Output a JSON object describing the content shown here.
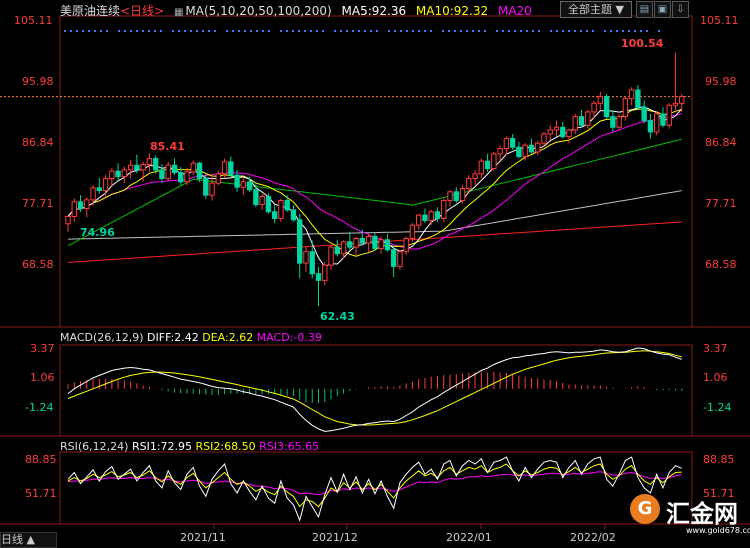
{
  "main_panel": {
    "instrument": "美原油连续",
    "period_label": "<日线>",
    "ma_label": "MA(5,10,20,50,100,200)",
    "ma5_label": "MA5:92.36",
    "ma10_label": "MA10:92.32",
    "ma20_label": "MA20",
    "theme_button": "全部主题",
    "peak_label": "100.54",
    "high_label_nov": "85.41",
    "low_label_oct": "74.96",
    "low_label_dec": "62.43",
    "y_ticks": [
      "105.11",
      "95.98",
      "86.84",
      "77.71",
      "68.58"
    ],
    "colors": {
      "up": "#ff3b3b",
      "down": "#00d4a0",
      "ma5": "#ffffff",
      "ma10": "#ffff00",
      "ma20": "#ff00ff",
      "ma50": "#00c000",
      "ma100": "#c0c0c0",
      "ma200": "#ff2020",
      "axis_text": "#ff3b3b",
      "dotted": "#3a7dff"
    }
  },
  "macd_panel": {
    "title": "MACD(26,12,9)",
    "diff_label": "DIFF:2.42",
    "dea_label": "DEA:2.62",
    "macd_label": "MACD:-0.39",
    "y_ticks": [
      "3.37",
      "1.06",
      "-1.24"
    ]
  },
  "rsi_panel": {
    "title": "RSI(6,12,24)",
    "rsi1_label": "RSI1:72.95",
    "rsi2_label": "RSI2:68.50",
    "rsi3_label": "RSI3:65.65",
    "y_ticks": [
      "88.85",
      "51.71"
    ]
  },
  "x_axis": {
    "labels": [
      "2021/11",
      "2021/12",
      "2022/01",
      "2022/02"
    ]
  },
  "footer": {
    "period_button": "日线 ▲"
  },
  "logo": {
    "text": "汇金网",
    "mark": "G",
    "url": "www.gold678.com"
  },
  "chart_data": {
    "type": "candlestick",
    "title": "美原油连续<日线>",
    "ylim": [
      62.43,
      105.11
    ],
    "series": [
      {
        "name": "MA5",
        "last": 92.36
      },
      {
        "name": "MA10",
        "last": 92.32
      },
      {
        "name": "MA20"
      }
    ],
    "annotations": [
      {
        "label": "85.41",
        "type": "high"
      },
      {
        "label": "74.96",
        "type": "low"
      },
      {
        "label": "62.43",
        "type": "low"
      },
      {
        "label": "100.54",
        "type": "high"
      }
    ],
    "candles": [
      [
        74.8,
        76.2,
        73.6,
        75.9
      ],
      [
        75.9,
        78.6,
        75.1,
        78.1
      ],
      [
        78.1,
        79.1,
        76.6,
        77.1
      ],
      [
        77.1,
        78.8,
        75.8,
        78.4
      ],
      [
        78.4,
        80.6,
        77.6,
        80.2
      ],
      [
        80.2,
        81.7,
        79.3,
        79.8
      ],
      [
        79.8,
        82.1,
        78.9,
        81.6
      ],
      [
        81.6,
        83.2,
        80.3,
        82.7
      ],
      [
        82.7,
        83.9,
        81.4,
        81.9
      ],
      [
        81.9,
        83.4,
        80.9,
        82.9
      ],
      [
        82.9,
        84.3,
        81.6,
        83.6
      ],
      [
        83.6,
        85.2,
        82.4,
        82.9
      ],
      [
        82.9,
        84.1,
        81.2,
        83.7
      ],
      [
        83.7,
        85.41,
        82.6,
        84.6
      ],
      [
        84.6,
        85.1,
        82.3,
        82.9
      ],
      [
        82.9,
        83.8,
        80.9,
        81.6
      ],
      [
        81.6,
        84.1,
        81.2,
        83.6
      ],
      [
        83.6,
        84.6,
        82.1,
        82.5
      ],
      [
        82.5,
        83.3,
        80.6,
        81.1
      ],
      [
        81.1,
        83.2,
        80.6,
        82.6
      ],
      [
        82.6,
        84.3,
        82.1,
        83.9
      ],
      [
        83.9,
        84.1,
        81.1,
        81.6
      ],
      [
        81.6,
        82.2,
        78.6,
        79.1
      ],
      [
        79.1,
        81.6,
        78.3,
        80.9
      ],
      [
        80.9,
        82.8,
        80.6,
        82.3
      ],
      [
        82.3,
        84.6,
        81.6,
        84.1
      ],
      [
        84.1,
        84.9,
        81.8,
        82.1
      ],
      [
        82.1,
        82.9,
        79.6,
        80.3
      ],
      [
        80.3,
        81.6,
        79.1,
        81.1
      ],
      [
        81.1,
        81.9,
        79.6,
        79.9
      ],
      [
        79.9,
        81.1,
        77.3,
        77.7
      ],
      [
        77.7,
        79.3,
        76.9,
        78.9
      ],
      [
        78.9,
        79.4,
        76.3,
        76.6
      ],
      [
        76.6,
        77.6,
        74.9,
        75.6
      ],
      [
        75.6,
        78.6,
        75.1,
        78.3
      ],
      [
        78.3,
        79.1,
        76.6,
        76.9
      ],
      [
        76.9,
        77.6,
        75.1,
        75.4
      ],
      [
        75.4,
        76.3,
        66.6,
        68.9
      ],
      [
        68.9,
        71.3,
        67.6,
        70.6
      ],
      [
        70.6,
        72.3,
        66.6,
        67.3
      ],
      [
        67.3,
        68.3,
        62.43,
        66.3
      ],
      [
        66.3,
        69.1,
        65.6,
        68.6
      ],
      [
        68.6,
        71.6,
        67.9,
        71.3
      ],
      [
        71.3,
        72.4,
        69.9,
        70.3
      ],
      [
        70.3,
        72.3,
        69.6,
        72.1
      ],
      [
        72.1,
        73.6,
        70.9,
        71.3
      ],
      [
        71.3,
        72.9,
        70.1,
        72.6
      ],
      [
        72.6,
        73.9,
        71.6,
        71.9
      ],
      [
        71.9,
        73.3,
        70.6,
        72.9
      ],
      [
        72.9,
        73.4,
        70.8,
        71.1
      ],
      [
        71.1,
        72.9,
        70.3,
        72.4
      ],
      [
        72.4,
        73.3,
        70.6,
        70.9
      ],
      [
        70.9,
        71.6,
        66.8,
        68.4
      ],
      [
        68.4,
        70.9,
        67.9,
        70.6
      ],
      [
        70.6,
        72.9,
        70.1,
        72.6
      ],
      [
        72.6,
        74.9,
        72.1,
        74.6
      ],
      [
        74.6,
        76.3,
        73.9,
        76.1
      ],
      [
        76.1,
        77.1,
        74.9,
        75.3
      ],
      [
        75.3,
        76.9,
        74.6,
        76.6
      ],
      [
        76.6,
        77.3,
        75.1,
        75.6
      ],
      [
        75.6,
        78.6,
        75.1,
        78.3
      ],
      [
        78.3,
        79.9,
        77.4,
        79.6
      ],
      [
        79.6,
        80.3,
        77.9,
        78.3
      ],
      [
        78.3,
        80.6,
        77.8,
        80.1
      ],
      [
        80.1,
        82.1,
        79.3,
        81.6
      ],
      [
        81.6,
        82.9,
        80.6,
        82.3
      ],
      [
        82.3,
        84.6,
        81.6,
        84.2
      ],
      [
        84.2,
        85.3,
        82.6,
        83.1
      ],
      [
        83.1,
        85.6,
        82.8,
        85.3
      ],
      [
        85.3,
        86.6,
        84.3,
        86.1
      ],
      [
        86.1,
        87.9,
        85.1,
        87.6
      ],
      [
        87.6,
        88.3,
        85.9,
        86.3
      ],
      [
        86.3,
        87.1,
        84.6,
        84.9
      ],
      [
        84.9,
        86.9,
        84.3,
        86.6
      ],
      [
        86.6,
        87.6,
        85.3,
        85.6
      ],
      [
        85.6,
        87.3,
        85.1,
        86.9
      ],
      [
        86.9,
        88.6,
        86.3,
        88.3
      ],
      [
        88.3,
        89.6,
        87.3,
        88.9
      ],
      [
        88.9,
        90.3,
        87.9,
        89.3
      ],
      [
        89.3,
        90.1,
        87.6,
        87.9
      ],
      [
        87.9,
        89.1,
        86.9,
        88.9
      ],
      [
        88.9,
        91.3,
        88.3,
        90.9
      ],
      [
        90.9,
        91.9,
        89.3,
        89.6
      ],
      [
        89.6,
        91.9,
        89.1,
        91.6
      ],
      [
        91.6,
        93.3,
        90.6,
        92.9
      ],
      [
        92.9,
        94.6,
        91.9,
        93.9
      ],
      [
        93.9,
        94.3,
        90.6,
        90.9
      ],
      [
        90.9,
        91.9,
        88.6,
        89.3
      ],
      [
        89.3,
        91.3,
        88.9,
        90.9
      ],
      [
        90.9,
        93.9,
        90.3,
        93.6
      ],
      [
        93.6,
        95.3,
        92.6,
        94.9
      ],
      [
        94.9,
        95.6,
        91.9,
        92.3
      ],
      [
        92.3,
        93.3,
        89.9,
        90.3
      ],
      [
        90.3,
        91.3,
        87.6,
        88.6
      ],
      [
        88.6,
        91.6,
        88.1,
        91.3
      ],
      [
        91.3,
        92.3,
        89.3,
        89.6
      ],
      [
        89.6,
        92.9,
        89.1,
        92.6
      ],
      [
        92.6,
        100.54,
        91.9,
        92.9
      ],
      [
        92.9,
        94.3,
        91.6,
        93.9
      ]
    ],
    "macd": {
      "diff": [
        -0.4,
        0.0,
        0.3,
        0.6,
        0.9,
        1.1,
        1.3,
        1.5,
        1.6,
        1.7,
        1.75,
        1.7,
        1.6,
        1.55,
        1.4,
        1.25,
        1.1,
        0.95,
        0.8,
        0.7,
        0.6,
        0.5,
        0.35,
        0.2,
        0.1,
        0.05,
        0.0,
        -0.1,
        -0.25,
        -0.35,
        -0.5,
        -0.6,
        -0.75,
        -0.9,
        -1.1,
        -1.3,
        -1.5,
        -2.1,
        -2.6,
        -3.0,
        -3.3,
        -3.5,
        -3.45,
        -3.35,
        -3.25,
        -3.1,
        -3.0,
        -2.95,
        -2.85,
        -2.8,
        -2.7,
        -2.65,
        -2.7,
        -2.5,
        -2.2,
        -1.9,
        -1.5,
        -1.2,
        -0.9,
        -0.65,
        -0.3,
        0.0,
        0.3,
        0.6,
        0.9,
        1.2,
        1.5,
        1.7,
        2.0,
        2.2,
        2.4,
        2.55,
        2.6,
        2.7,
        2.75,
        2.85,
        2.9,
        3.0,
        3.05,
        3.0,
        2.95,
        3.0,
        3.0,
        3.05,
        3.1,
        3.2,
        3.15,
        3.05,
        3.0,
        3.05,
        3.2,
        3.35,
        3.3,
        3.1,
        2.95,
        2.85,
        2.8,
        2.6,
        2.42
      ],
      "dea": [
        -0.8,
        -0.6,
        -0.4,
        -0.2,
        0.0,
        0.2,
        0.4,
        0.6,
        0.8,
        0.95,
        1.1,
        1.2,
        1.3,
        1.35,
        1.38,
        1.37,
        1.34,
        1.3,
        1.22,
        1.15,
        1.07,
        0.98,
        0.88,
        0.77,
        0.66,
        0.55,
        0.45,
        0.34,
        0.22,
        0.11,
        0.0,
        -0.12,
        -0.25,
        -0.38,
        -0.52,
        -0.68,
        -0.85,
        -1.1,
        -1.4,
        -1.7,
        -2.0,
        -2.3,
        -2.5,
        -2.7,
        -2.8,
        -2.9,
        -2.95,
        -2.98,
        -2.98,
        -2.96,
        -2.92,
        -2.88,
        -2.85,
        -2.8,
        -2.7,
        -2.55,
        -2.38,
        -2.2,
        -2.0,
        -1.8,
        -1.55,
        -1.3,
        -1.05,
        -0.8,
        -0.55,
        -0.3,
        -0.05,
        0.2,
        0.45,
        0.7,
        0.95,
        1.2,
        1.4,
        1.6,
        1.75,
        1.9,
        2.05,
        2.2,
        2.35,
        2.45,
        2.55,
        2.62,
        2.68,
        2.74,
        2.8,
        2.88,
        2.94,
        2.97,
        2.98,
        3.0,
        3.05,
        3.1,
        3.12,
        3.1,
        3.05,
        2.98,
        2.9,
        2.75,
        2.62
      ]
    },
    "rsi": {
      "rsi1": [
        60,
        68,
        55,
        63,
        71,
        58,
        69,
        75,
        60,
        66,
        72,
        58,
        68,
        76,
        58,
        50,
        70,
        56,
        48,
        66,
        74,
        52,
        40,
        60,
        70,
        78,
        55,
        44,
        58,
        46,
        36,
        52,
        38,
        32,
        58,
        38,
        30,
        12,
        40,
        28,
        16,
        42,
        62,
        45,
        66,
        48,
        63,
        44,
        60,
        43,
        58,
        40,
        26,
        56,
        66,
        74,
        80,
        66,
        72,
        60,
        78,
        82,
        64,
        76,
        82,
        78,
        84,
        68,
        80,
        82,
        86,
        70,
        58,
        74,
        62,
        72,
        80,
        82,
        80,
        62,
        74,
        82,
        66,
        78,
        84,
        86,
        60,
        52,
        66,
        82,
        86,
        62,
        50,
        44,
        66,
        50,
        68,
        76,
        72.95
      ],
      "rsi2": [
        58,
        62,
        58,
        61,
        66,
        62,
        65,
        69,
        63,
        65,
        68,
        62,
        65,
        70,
        62,
        57,
        64,
        58,
        54,
        62,
        67,
        58,
        50,
        56,
        62,
        68,
        60,
        54,
        57,
        52,
        46,
        50,
        45,
        42,
        52,
        45,
        40,
        28,
        36,
        34,
        28,
        38,
        50,
        45,
        56,
        50,
        57,
        48,
        55,
        48,
        54,
        46,
        38,
        50,
        58,
        64,
        70,
        64,
        67,
        62,
        70,
        74,
        66,
        70,
        74,
        72,
        76,
        68,
        72,
        74,
        78,
        70,
        64,
        70,
        65,
        68,
        72,
        74,
        73,
        65,
        69,
        74,
        68,
        72,
        76,
        78,
        66,
        60,
        64,
        72,
        76,
        66,
        58,
        54,
        62,
        56,
        63,
        68,
        68.5
      ],
      "rsi3": [
        57,
        58,
        58,
        59,
        60,
        60,
        61,
        62,
        61,
        61,
        62,
        61,
        61,
        62,
        61,
        59,
        60,
        58,
        57,
        58,
        59,
        58,
        55,
        56,
        57,
        58,
        57,
        55,
        55,
        54,
        52,
        52,
        51,
        49,
        50,
        49,
        47,
        43,
        44,
        43,
        42,
        44,
        47,
        46,
        49,
        48,
        50,
        48,
        50,
        48,
        50,
        48,
        46,
        48,
        51,
        54,
        57,
        56,
        57,
        56,
        59,
        61,
        60,
        61,
        63,
        63,
        64,
        63,
        64,
        65,
        66,
        65,
        64,
        65,
        64,
        65,
        66,
        67,
        67,
        65,
        66,
        67,
        66,
        67,
        68,
        69,
        67,
        65,
        65,
        67,
        68,
        66,
        63,
        61,
        62,
        61,
        62,
        64,
        65.65
      ]
    }
  }
}
